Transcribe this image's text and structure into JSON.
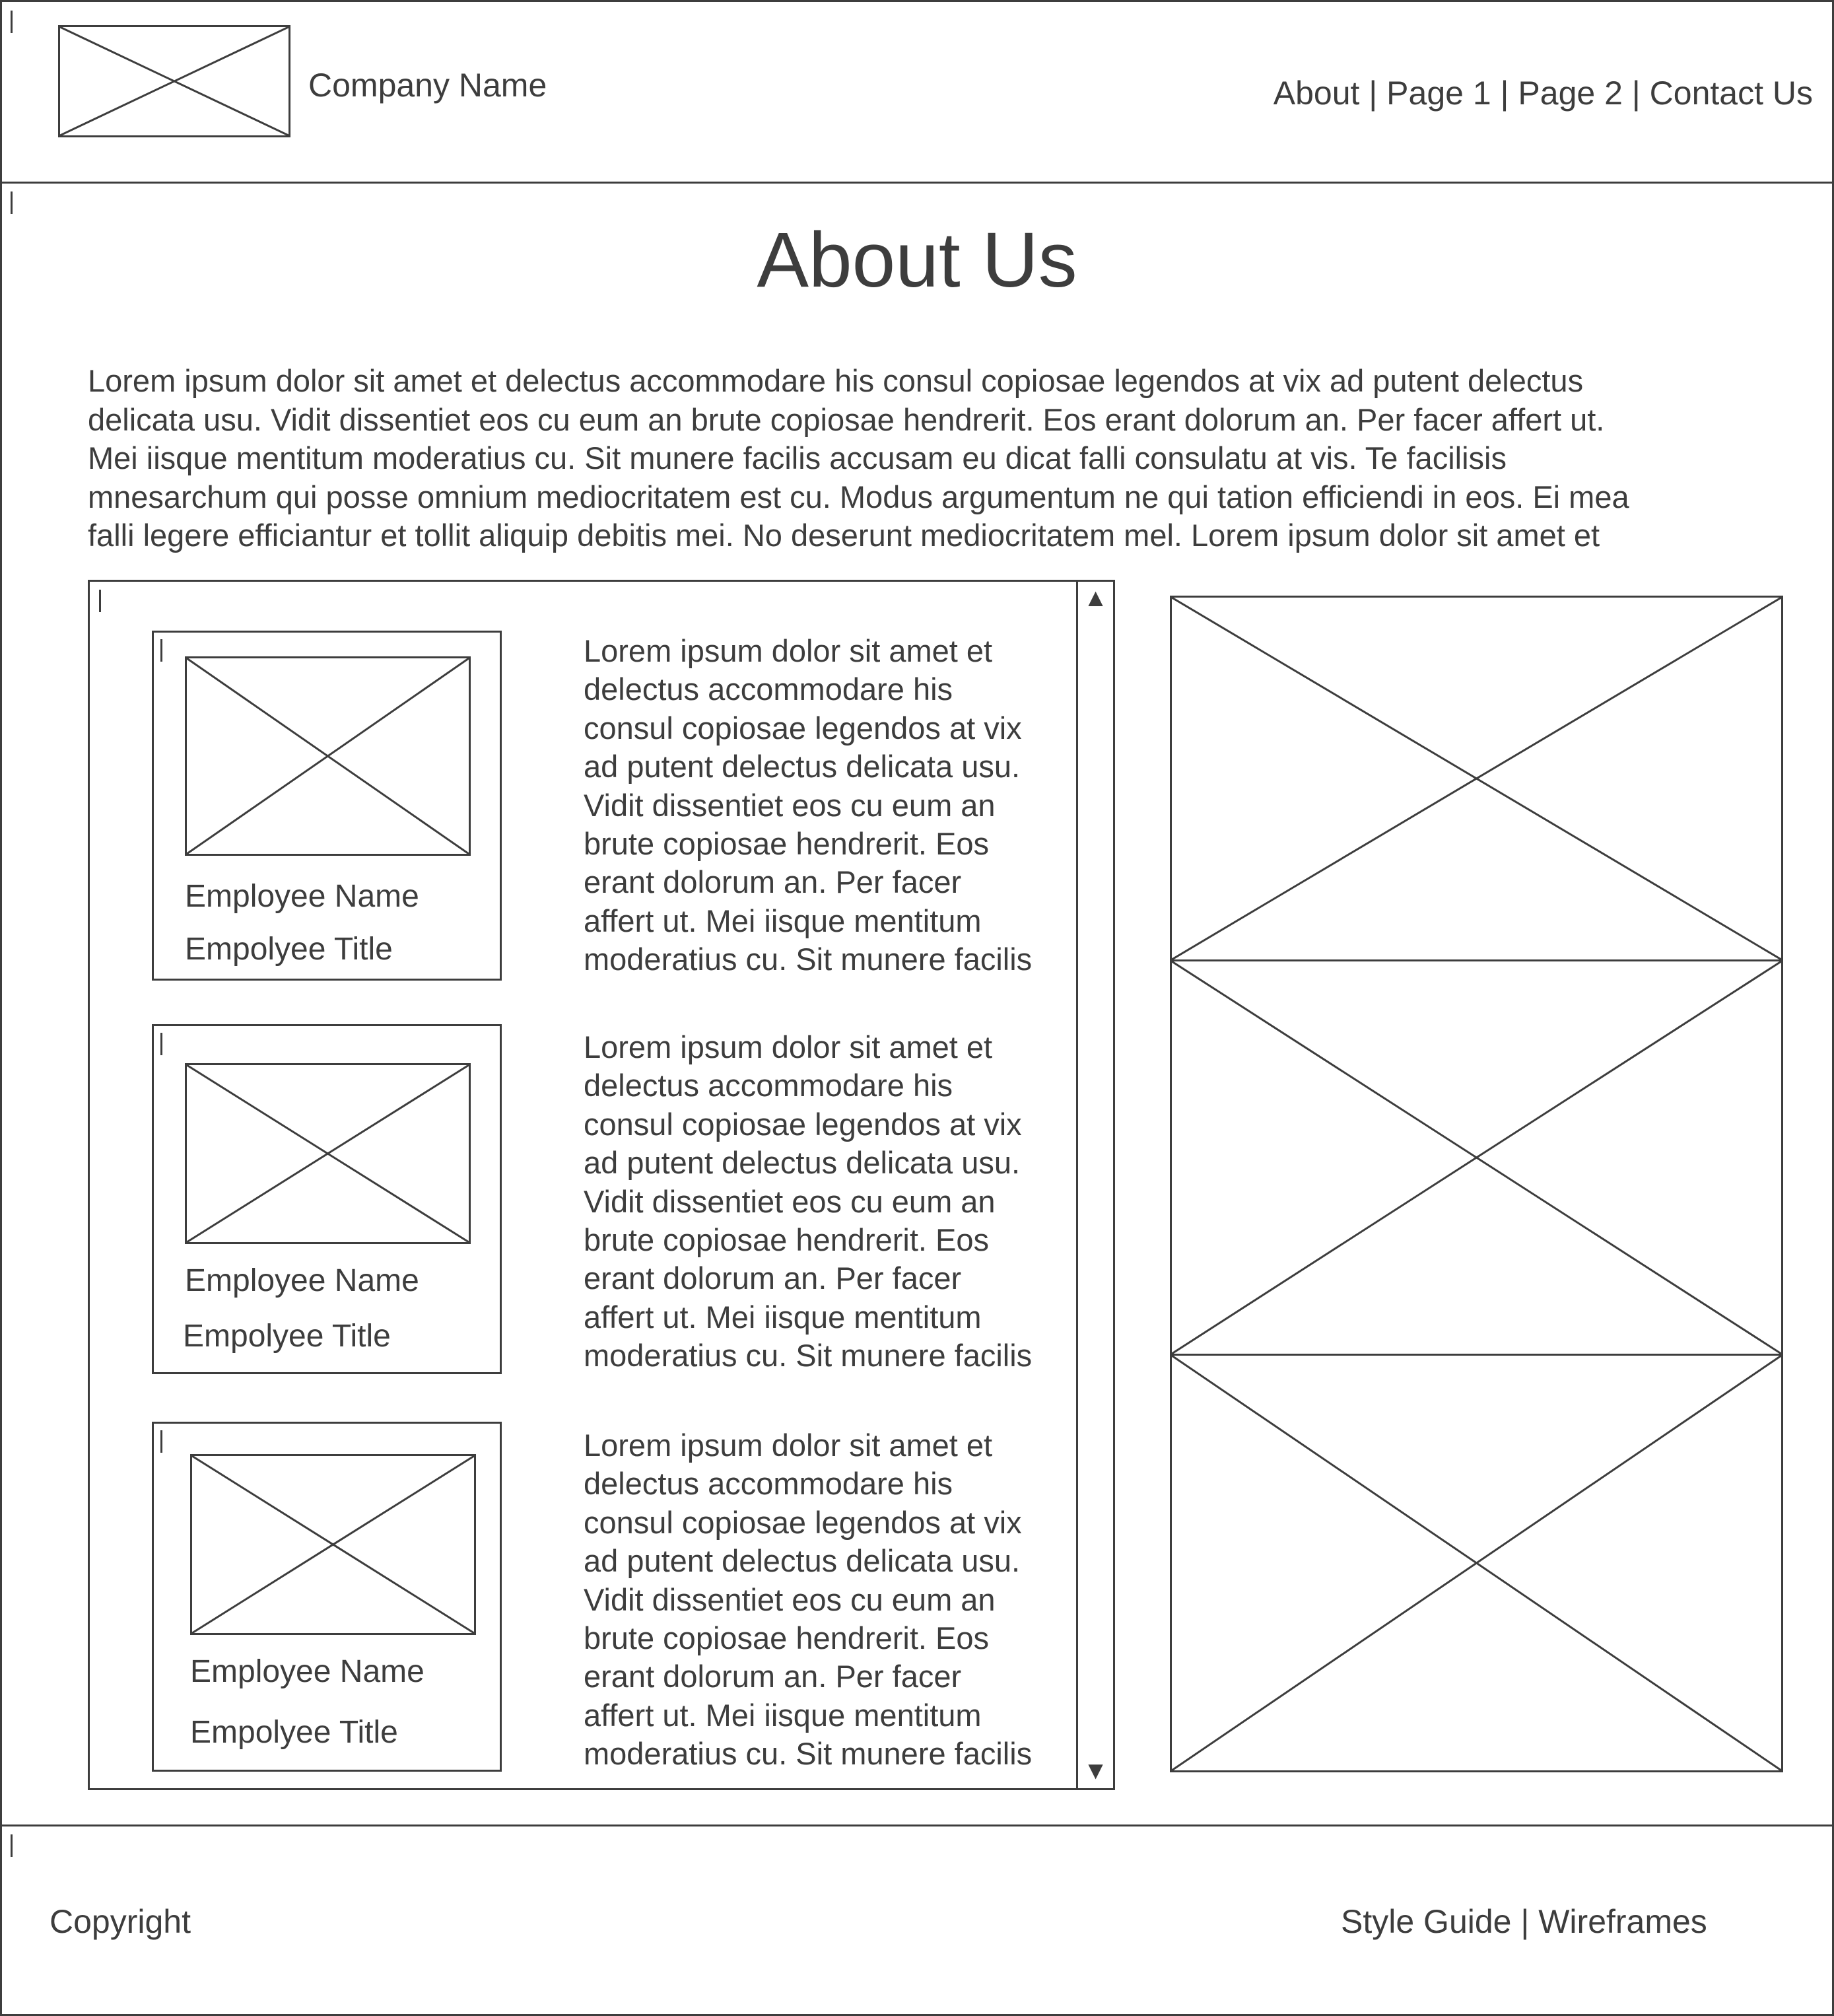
{
  "header": {
    "company_name": "Company Name",
    "nav": "About | Page 1 | Page 2 | Contact Us"
  },
  "main": {
    "title": "About Us",
    "intro_lines": [
      "Lorem ipsum dolor sit amet et delectus accommodare his consul copiosae legendos at vix ad putent delectus",
      "delicata usu. Vidit dissentiet eos cu eum an brute copiosae hendrerit. Eos erant dolorum an. Per facer affert ut.",
      "Mei iisque mentitum moderatius cu. Sit munere facilis accusam eu dicat falli consulatu at vis. Te facilisis",
      "mnesarchum qui posse omnium mediocritatem est cu. Modus argumentum ne qui tation efficiendi in eos. Ei mea",
      "falli legere efficiantur et tollit aliquip debitis mei. No deserunt mediocritatem mel. Lorem ipsum dolor sit amet et"
    ],
    "employees": [
      {
        "name": "Employee Name",
        "title": "Empolyee Title",
        "bio_lines": [
          "Lorem ipsum dolor sit amet et",
          "delectus accommodare his",
          "consul copiosae legendos at vix",
          "ad putent delectus delicata usu.",
          "Vidit dissentiet eos cu eum an",
          "brute copiosae hendrerit. Eos",
          "erant dolorum an. Per facer",
          "affert ut. Mei iisque mentitum",
          "moderatius cu. Sit munere facilis"
        ]
      },
      {
        "name": "Employee Name",
        "title": "Empolyee Title",
        "bio_lines": [
          "Lorem ipsum dolor sit amet et",
          "delectus accommodare his",
          "consul copiosae legendos at vix",
          "ad putent delectus delicata usu.",
          "Vidit dissentiet eos cu eum an",
          "brute copiosae hendrerit. Eos",
          "erant dolorum an. Per facer",
          "affert ut. Mei iisque mentitum",
          "moderatius cu. Sit munere facilis"
        ]
      },
      {
        "name": "Employee Name",
        "title": "Empolyee Title",
        "bio_lines": [
          "Lorem ipsum dolor sit amet et",
          "delectus accommodare his",
          "consul copiosae legendos at vix",
          "ad putent delectus delicata usu.",
          "Vidit dissentiet eos cu eum an",
          "brute copiosae hendrerit. Eos",
          "erant dolorum an. Per facer",
          "affert ut. Mei iisque mentitum",
          "moderatius cu. Sit munere facilis"
        ]
      }
    ],
    "scroll_up_icon": "▲",
    "scroll_down_icon": "▼"
  },
  "footer": {
    "copyright": "Copyright",
    "links": "Style Guide | Wireframes"
  },
  "colors": {
    "stroke": "#3d3d3d",
    "background": "#ffffff"
  }
}
